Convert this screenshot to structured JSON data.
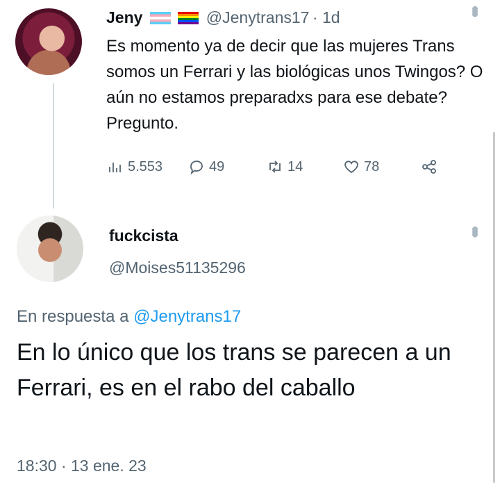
{
  "tweet": {
    "author_name": "Jeny",
    "author_handle": "@Jenytrans17",
    "age": "· 1d",
    "text": "Es momento ya de decir que las mujeres Trans somos un Ferrari y las biológicas unos Twingos? O aún no estamos preparadxs para ese debate? Pregunto.",
    "views": "5.553",
    "replies": "49",
    "retweets": "14",
    "likes": "78"
  },
  "reply": {
    "author_name": "fuckcista",
    "author_handle": "@Moises51135296",
    "in_reply_prefix": "En respuesta a",
    "in_reply_handle": "@Jenytrans17",
    "text": "En lo único que los trans se parecen a un Ferrari, es en el rabo del caballo",
    "timestamp": "18:30 · 13 ene. 23"
  },
  "icons": {
    "views": "bar-chart-icon",
    "replies": "reply-bubble-icon",
    "retweets": "retweet-icon",
    "likes": "heart-icon",
    "share": "share-icon",
    "more": "more-dots-icon",
    "flags": [
      "transgender-flag-emoji",
      "rainbow-flag-emoji"
    ]
  },
  "colors": {
    "link": "#1d9bf0",
    "secondary_text": "#536471",
    "primary_text": "#0f1419"
  }
}
